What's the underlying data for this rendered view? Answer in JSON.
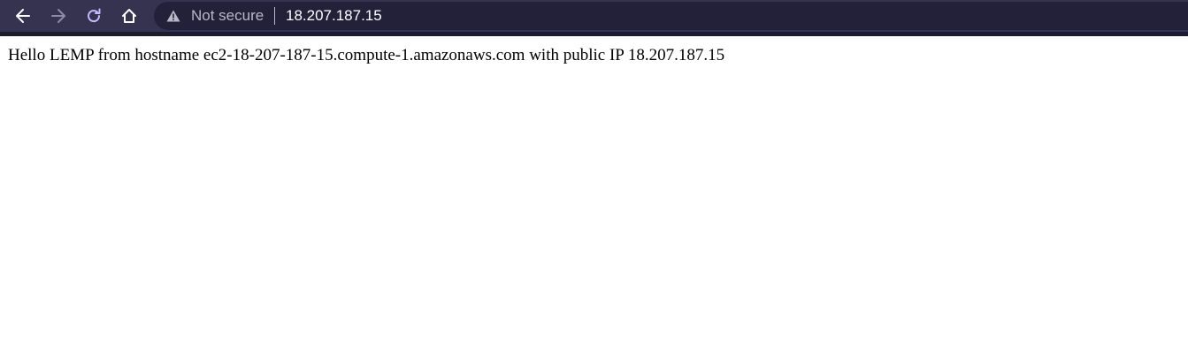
{
  "browser": {
    "toolbar_color": "#35334f",
    "icons": [
      "back-icon",
      "forward-icon",
      "reload-icon",
      "home-icon",
      "warning-icon"
    ],
    "security_label": "Not secure",
    "url": "18.207.187.15"
  },
  "page": {
    "text": "Hello LEMP from hostname ec2-18-207-187-15.compute-1.amazonaws.com with public IP 18.207.187.15"
  }
}
